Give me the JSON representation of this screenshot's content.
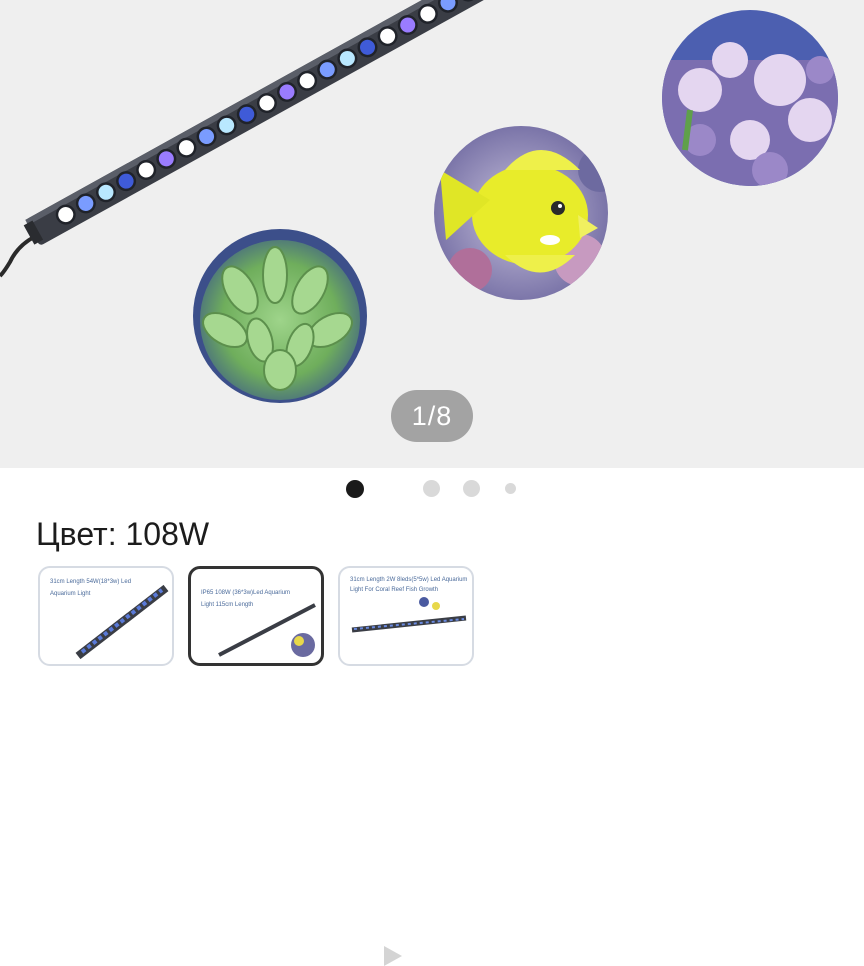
{
  "gallery": {
    "counter": "1/8",
    "total_images": 8,
    "current_index": 1,
    "main_image": "aquarium-led-light-bar-with-coral-and-fish"
  },
  "pagination": {
    "dots": [
      "active",
      "video",
      "inactive",
      "inactive",
      "small"
    ]
  },
  "product": {
    "color_label": "Цвет: 108W"
  },
  "thumbnails": [
    {
      "caption1": "31cm Length 54W(18*3w) Led",
      "caption2": "Aquarium Light",
      "selected": false
    },
    {
      "caption1": "IP65 108W (36*3w)Led Aquarium",
      "caption2": "Light 115cm Length",
      "selected": true
    },
    {
      "caption1": "31cm Length 2W 8leds(5*5w) Led Aquarium",
      "caption2": "Light For Coral Reef Fish Growth",
      "selected": false
    }
  ],
  "colors": {
    "gallery_bg": "#efefef",
    "counter_bg": "#a3a3a3",
    "active_dot": "#1a1a1a",
    "inactive_dot": "#d9d9d9"
  }
}
